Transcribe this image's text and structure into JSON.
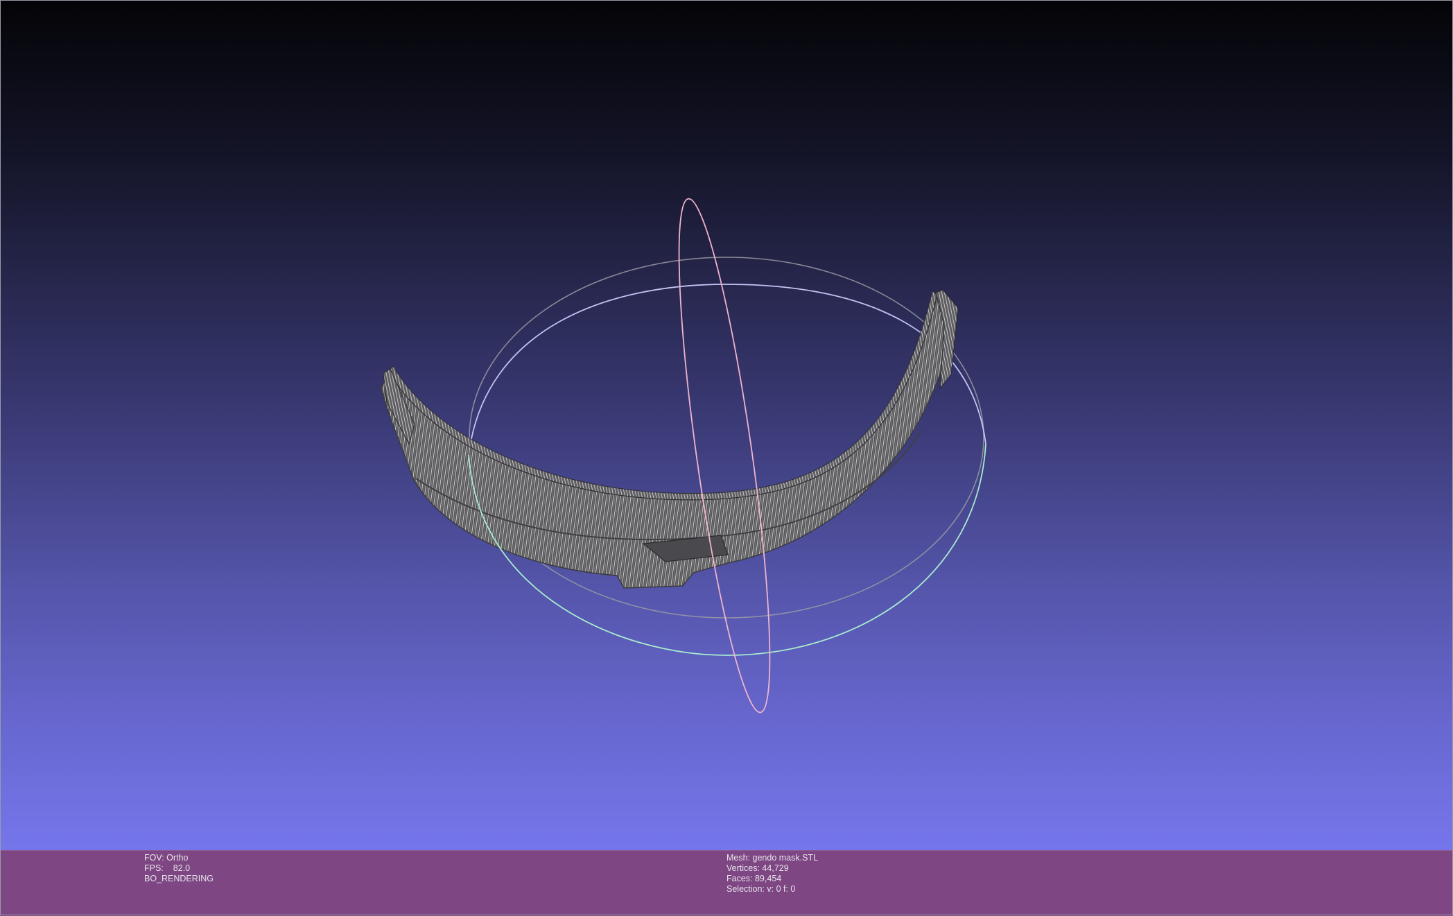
{
  "viewport": {
    "background_top": "#040407",
    "background_bottom": "#7676ec",
    "mesh_color": "#6e6e6e",
    "trackball": {
      "x_ring_color": "#f0b4cc",
      "y_ring_color": "#c4c4f4",
      "z_ring_color": "#a8ecd0",
      "back_ring_color": "#9a9aa4"
    }
  },
  "info_bar": {
    "background": "#7e4683",
    "left": {
      "fov": "FOV: Ortho",
      "fps_label": "FPS:",
      "fps_value": "82.0",
      "rendering": "BO_RENDERING"
    },
    "right": {
      "mesh": "Mesh: gendo mask.STL",
      "vertices": "Vertices: 44,729",
      "faces": "Faces: 89,454",
      "selection": "Selection: v: 0 f: 0"
    }
  }
}
